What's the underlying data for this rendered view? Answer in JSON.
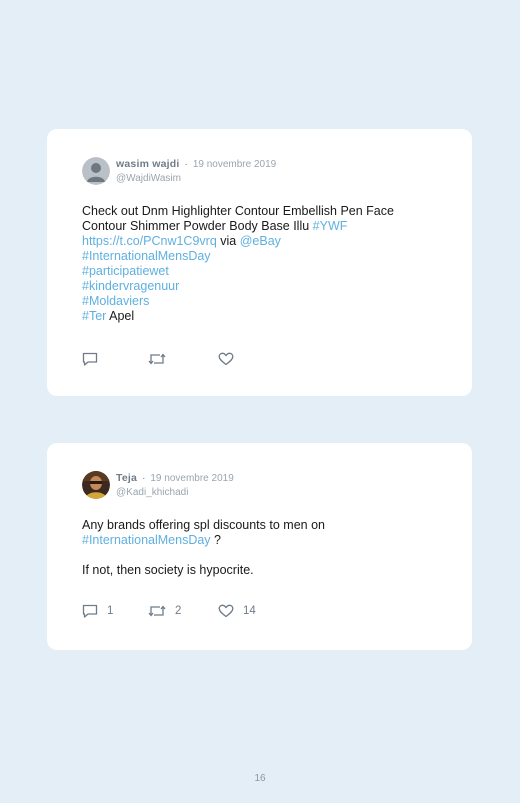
{
  "tweets": [
    {
      "name": "wasim wajdi",
      "separator": "·",
      "date": "19 novembre 2019",
      "handle": "@WajdiWasim",
      "line1": "Check out Dnm Highlighter Contour Embellish Pen Face",
      "line2_text": "Contour Shimmer Powder Body Base Illu ",
      "line2_hashtag": "#YWF",
      "line3_url": "https://t.co/PCnw1C9vrq",
      "line3_via": " via ",
      "line3_mention": "@eBay",
      "hashtag_1": "#InternationalMensDay",
      "hashtag_2": "#participatiewet",
      "hashtag_3": "#kindervragenuur",
      "hashtag_4": "#Moldaviers",
      "hashtag_5": "#Ter",
      "last_word": " Apel",
      "replies": "",
      "retweets": "",
      "likes": ""
    },
    {
      "name": "Teja",
      "separator": "·",
      "date": "19 novembre 2019",
      "handle": "@Kadi_khichadi",
      "line1": "Any brands offering spl discounts to men on",
      "hashtag": "#InternationalMensDay",
      "line2_after": " ?",
      "line3": "If not, then society is hypocrite.",
      "replies": "1",
      "retweets": "2",
      "likes": "14"
    }
  ],
  "icons": {
    "reply": "comment-icon",
    "retweet": "retweet-icon",
    "like": "heart-icon",
    "avatar_default": "default-avatar-icon",
    "avatar_photo": "profile-photo"
  },
  "colors": {
    "background": "#e3eef6",
    "card": "#ffffff",
    "link": "#5fb0e0",
    "meta": "#9aa5ae"
  },
  "page_number": "16"
}
